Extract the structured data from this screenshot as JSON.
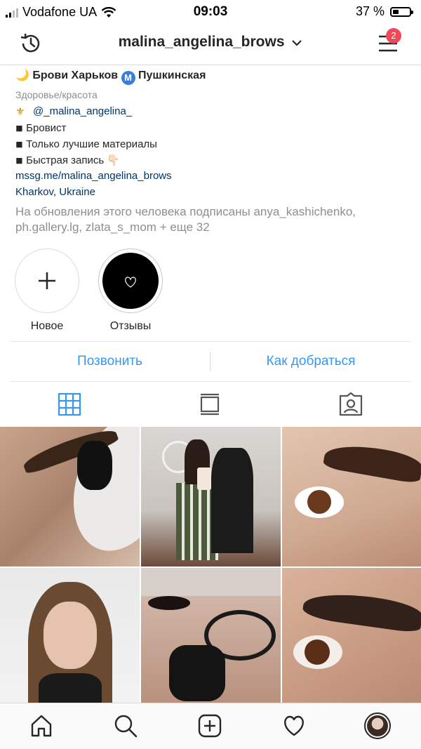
{
  "status_bar": {
    "carrier": "Vodafone UA",
    "time": "09:03",
    "battery": "37 %",
    "battery_level": 0.37
  },
  "nav": {
    "username": "malina_angelina_brows",
    "notification_count": "2"
  },
  "bio": {
    "name": "Брови Харьков",
    "name_suffix": "Пушкинская",
    "category": "Здоровье/красота",
    "lines": [
      "@_malina_angelina_",
      "Бровист",
      "Только лучшие материалы",
      "Быстрая запись"
    ],
    "link": "mssg.me/malina_angelina_brows",
    "location": "Kharkov, Ukraine",
    "followed_by": "На обновления этого человека подписаны anya_kashichenko, ph.gallery.lg, zlata_s_mom + еще 32"
  },
  "highlights": [
    {
      "label": "Новое"
    },
    {
      "label": "Отзывы"
    }
  ],
  "actions": {
    "call": "Позвонить",
    "directions": "Как добраться"
  },
  "profile_tabs": [
    "grid",
    "feed",
    "tagged"
  ],
  "grid": [
    {
      "name": "photo-brow-lash-pad"
    },
    {
      "name": "photo-mirror-selfie"
    },
    {
      "name": "photo-eye-closeup"
    },
    {
      "name": "photo-portrait-woman"
    },
    {
      "name": "photo-brow-procedure"
    },
    {
      "name": "photo-eye-brow-closeup"
    }
  ],
  "colors": {
    "link": "#3897f0",
    "badge": "#ed4956",
    "muted": "#8e8e8e",
    "accent_tab": "#3897f0"
  }
}
